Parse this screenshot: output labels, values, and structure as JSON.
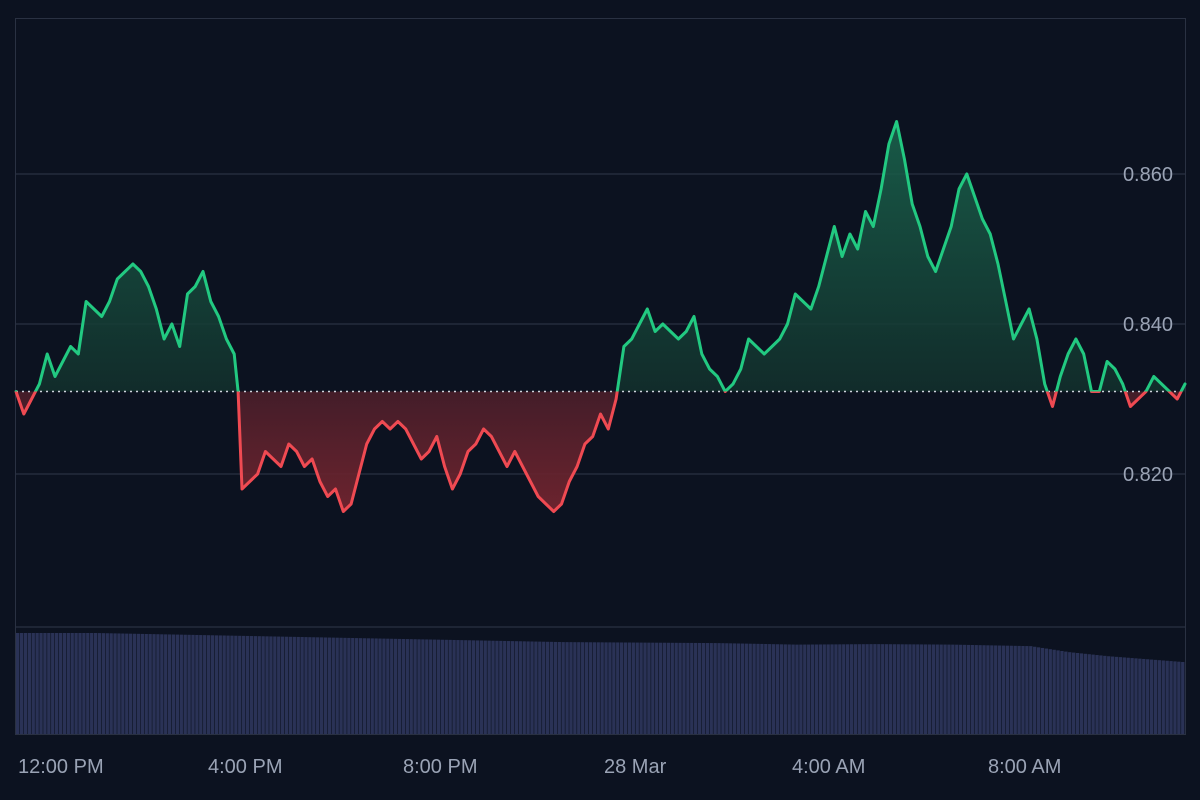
{
  "chart_data": {
    "type": "line",
    "baseline": 0.831,
    "ylim": [
      0.795,
      0.88
    ],
    "y_ticks": [
      {
        "value": 0.82,
        "label": "0.820"
      },
      {
        "value": 0.84,
        "label": "0.840"
      },
      {
        "value": 0.86,
        "label": "0.860"
      }
    ],
    "x_ticks": [
      "12:00 PM",
      "4:00 PM",
      "8:00 PM",
      "28 Mar",
      "4:00 AM",
      "8:00 AM"
    ],
    "grid": true,
    "colors": {
      "background": "#0c1220",
      "up": "#22c981",
      "down": "#ef4a52",
      "volume": "#2a3256",
      "grid": "#2a3142",
      "baseline": "#cfd4dd"
    },
    "price": [
      [
        0,
        0.831
      ],
      [
        2,
        0.828
      ],
      [
        4,
        0.83
      ],
      [
        6,
        0.832
      ],
      [
        8,
        0.836
      ],
      [
        10,
        0.833
      ],
      [
        12,
        0.835
      ],
      [
        14,
        0.837
      ],
      [
        16,
        0.836
      ],
      [
        18,
        0.843
      ],
      [
        20,
        0.842
      ],
      [
        22,
        0.841
      ],
      [
        24,
        0.843
      ],
      [
        26,
        0.846
      ],
      [
        28,
        0.847
      ],
      [
        30,
        0.848
      ],
      [
        32,
        0.847
      ],
      [
        34,
        0.845
      ],
      [
        36,
        0.842
      ],
      [
        38,
        0.838
      ],
      [
        40,
        0.84
      ],
      [
        42,
        0.837
      ],
      [
        44,
        0.844
      ],
      [
        46,
        0.845
      ],
      [
        48,
        0.847
      ],
      [
        50,
        0.843
      ],
      [
        52,
        0.841
      ],
      [
        54,
        0.838
      ],
      [
        56,
        0.836
      ],
      [
        57,
        0.831
      ],
      [
        58,
        0.818
      ],
      [
        60,
        0.819
      ],
      [
        62,
        0.82
      ],
      [
        64,
        0.823
      ],
      [
        66,
        0.822
      ],
      [
        68,
        0.821
      ],
      [
        70,
        0.824
      ],
      [
        72,
        0.823
      ],
      [
        74,
        0.821
      ],
      [
        76,
        0.822
      ],
      [
        78,
        0.819
      ],
      [
        80,
        0.817
      ],
      [
        82,
        0.818
      ],
      [
        84,
        0.815
      ],
      [
        86,
        0.816
      ],
      [
        88,
        0.82
      ],
      [
        90,
        0.824
      ],
      [
        92,
        0.826
      ],
      [
        94,
        0.827
      ],
      [
        96,
        0.826
      ],
      [
        98,
        0.827
      ],
      [
        100,
        0.826
      ],
      [
        102,
        0.824
      ],
      [
        104,
        0.822
      ],
      [
        106,
        0.823
      ],
      [
        108,
        0.825
      ],
      [
        110,
        0.821
      ],
      [
        112,
        0.818
      ],
      [
        114,
        0.82
      ],
      [
        116,
        0.823
      ],
      [
        118,
        0.824
      ],
      [
        120,
        0.826
      ],
      [
        122,
        0.825
      ],
      [
        124,
        0.823
      ],
      [
        126,
        0.821
      ],
      [
        128,
        0.823
      ],
      [
        130,
        0.821
      ],
      [
        132,
        0.819
      ],
      [
        134,
        0.817
      ],
      [
        136,
        0.816
      ],
      [
        138,
        0.815
      ],
      [
        140,
        0.816
      ],
      [
        142,
        0.819
      ],
      [
        144,
        0.821
      ],
      [
        146,
        0.824
      ],
      [
        148,
        0.825
      ],
      [
        150,
        0.828
      ],
      [
        152,
        0.826
      ],
      [
        154,
        0.83
      ],
      [
        156,
        0.837
      ],
      [
        158,
        0.838
      ],
      [
        160,
        0.84
      ],
      [
        162,
        0.842
      ],
      [
        164,
        0.839
      ],
      [
        166,
        0.84
      ],
      [
        168,
        0.839
      ],
      [
        170,
        0.838
      ],
      [
        172,
        0.839
      ],
      [
        174,
        0.841
      ],
      [
        176,
        0.836
      ],
      [
        178,
        0.834
      ],
      [
        180,
        0.833
      ],
      [
        182,
        0.831
      ],
      [
        184,
        0.832
      ],
      [
        186,
        0.834
      ],
      [
        188,
        0.838
      ],
      [
        190,
        0.837
      ],
      [
        192,
        0.836
      ],
      [
        194,
        0.837
      ],
      [
        196,
        0.838
      ],
      [
        198,
        0.84
      ],
      [
        200,
        0.844
      ],
      [
        202,
        0.843
      ],
      [
        204,
        0.842
      ],
      [
        206,
        0.845
      ],
      [
        208,
        0.849
      ],
      [
        210,
        0.853
      ],
      [
        212,
        0.849
      ],
      [
        214,
        0.852
      ],
      [
        216,
        0.85
      ],
      [
        218,
        0.855
      ],
      [
        220,
        0.853
      ],
      [
        222,
        0.858
      ],
      [
        224,
        0.864
      ],
      [
        226,
        0.867
      ],
      [
        228,
        0.862
      ],
      [
        230,
        0.856
      ],
      [
        232,
        0.853
      ],
      [
        234,
        0.849
      ],
      [
        236,
        0.847
      ],
      [
        238,
        0.85
      ],
      [
        240,
        0.853
      ],
      [
        242,
        0.858
      ],
      [
        244,
        0.86
      ],
      [
        246,
        0.857
      ],
      [
        248,
        0.854
      ],
      [
        250,
        0.852
      ],
      [
        252,
        0.848
      ],
      [
        254,
        0.843
      ],
      [
        256,
        0.838
      ],
      [
        258,
        0.84
      ],
      [
        260,
        0.842
      ],
      [
        262,
        0.838
      ],
      [
        264,
        0.832
      ],
      [
        266,
        0.829
      ],
      [
        268,
        0.833
      ],
      [
        270,
        0.836
      ],
      [
        272,
        0.838
      ],
      [
        274,
        0.836
      ],
      [
        276,
        0.831
      ],
      [
        278,
        0.831
      ],
      [
        280,
        0.835
      ],
      [
        282,
        0.834
      ],
      [
        284,
        0.832
      ],
      [
        286,
        0.829
      ],
      [
        288,
        0.83
      ],
      [
        290,
        0.831
      ],
      [
        292,
        0.833
      ],
      [
        294,
        0.832
      ],
      [
        296,
        0.831
      ],
      [
        298,
        0.83
      ],
      [
        300,
        0.832
      ]
    ],
    "volume": [
      [
        0,
        1.0
      ],
      [
        20,
        1.0
      ],
      [
        40,
        0.985
      ],
      [
        60,
        0.97
      ],
      [
        80,
        0.955
      ],
      [
        100,
        0.94
      ],
      [
        120,
        0.925
      ],
      [
        140,
        0.91
      ],
      [
        160,
        0.905
      ],
      [
        180,
        0.9
      ],
      [
        200,
        0.885
      ],
      [
        220,
        0.89
      ],
      [
        240,
        0.885
      ],
      [
        260,
        0.87
      ],
      [
        270,
        0.81
      ],
      [
        280,
        0.77
      ],
      [
        290,
        0.74
      ],
      [
        300,
        0.71
      ]
    ]
  }
}
